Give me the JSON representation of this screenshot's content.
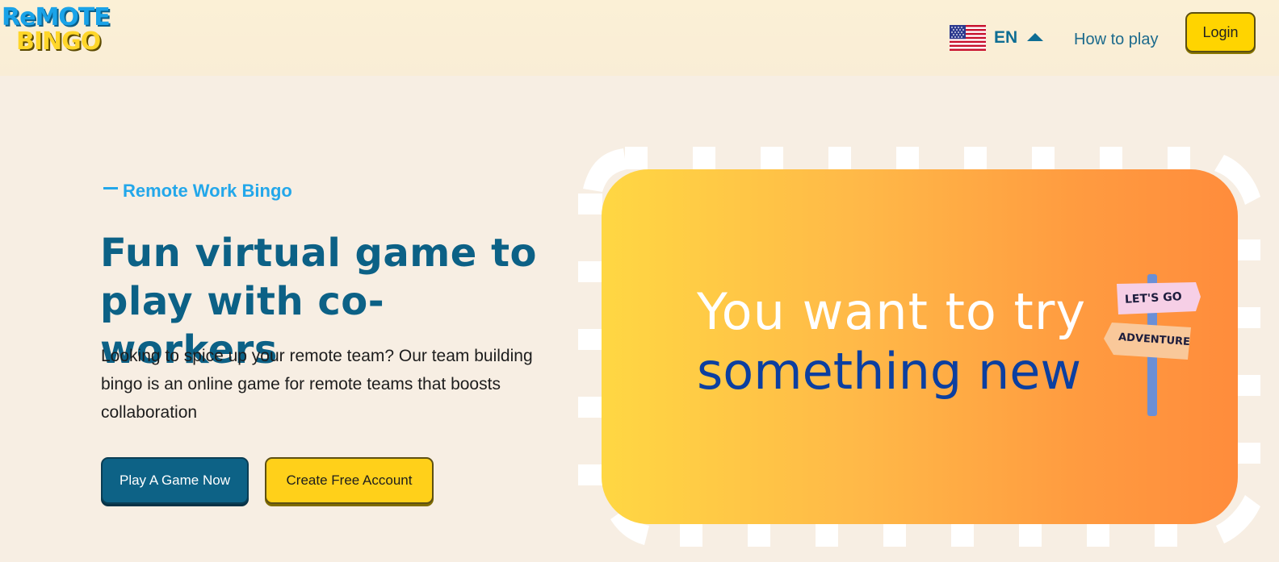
{
  "header": {
    "logo": {
      "line1": "ReMOTE",
      "line2": "BINGO"
    },
    "language": {
      "code": "EN",
      "flag_icon": "us-flag-icon"
    },
    "nav": {
      "how_to_play": "How to play"
    },
    "login_label": "Login"
  },
  "hero": {
    "eyebrow": "Remote Work Bingo",
    "headline_line1": "Fun virtual game to",
    "headline_line2": "play with co-workers",
    "description": "Looking to spice up your remote team? Our team building bingo is an online game for remote teams that boosts collaboration",
    "buttons": {
      "play": "Play A Game Now",
      "create": "Create Free Account"
    }
  },
  "promo": {
    "line1": "You want to try",
    "line2": "something new",
    "sign_top": "LET'S GO",
    "sign_bottom": "ADVENTURE"
  },
  "colors": {
    "brand_blue": "#0c6186",
    "accent_yellow": "#ffd01a",
    "accent_sky": "#23a7ea",
    "background": "#f7eee3"
  }
}
